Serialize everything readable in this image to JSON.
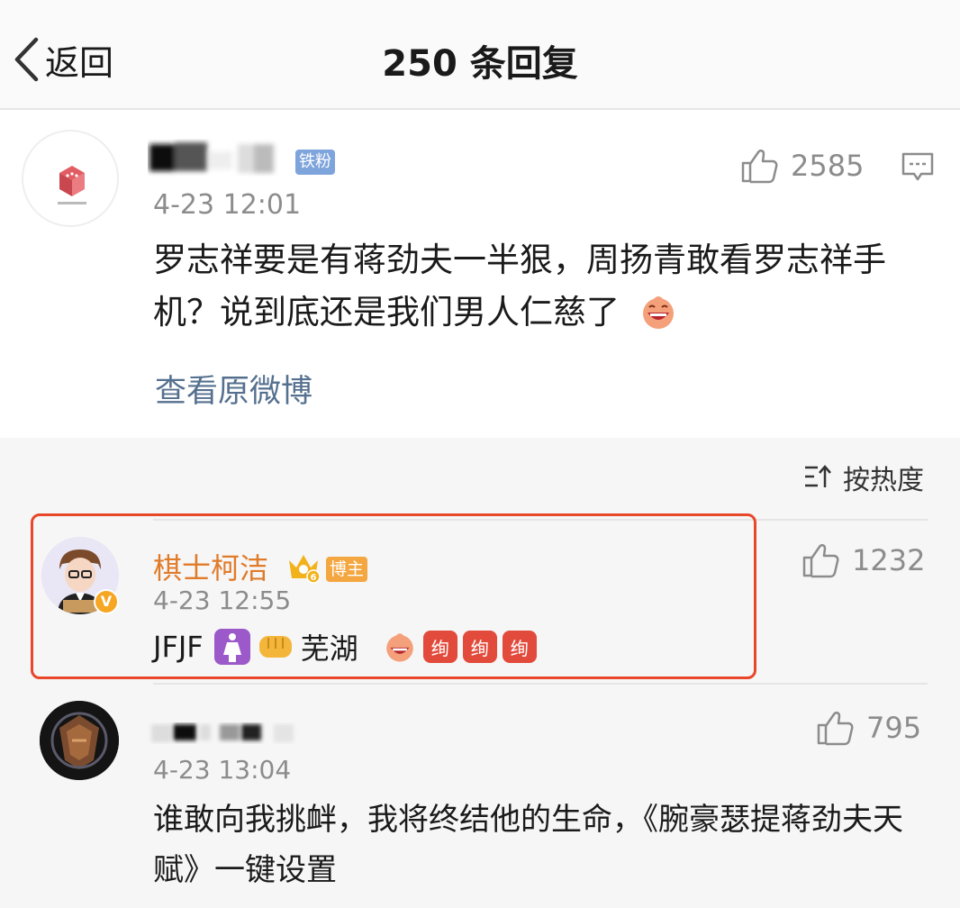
{
  "header": {
    "back_label": "返回",
    "title": "250 条回复"
  },
  "main_post": {
    "badge": "铁粉",
    "time": "4-23 12:01",
    "likes": "2585",
    "content": "罗志祥要是有蒋劲夫一半狠，周扬青敢看罗志祥手机？说到底还是我们男人仁慈了",
    "emoji": "laughing-face-emoji",
    "view_original": "查看原微博"
  },
  "replies_header": {
    "sort_label": "按热度",
    "sort_icon": "sort-icon"
  },
  "replies": [
    {
      "username": "棋士柯洁",
      "crown_level": "6",
      "badge": "博主",
      "verified_mark": "V",
      "time": "4-23 12:55",
      "likes": "1232",
      "text_1": "JFJF",
      "text_2": "芜湖",
      "emoji_tag": "绚",
      "highlighted": true,
      "highlight_color": "#e8472a"
    },
    {
      "time": "4-23 13:04",
      "likes": "795",
      "content": "谁敢向我挑衅，我将终结他的生命，《腕豪瑟提蒋劲夫天赋》一键设置"
    }
  ],
  "colors": {
    "link": "#55708f",
    "username_vip": "#e07b2a",
    "badge_blue": "#7ea4dc",
    "badge_orange": "#f4a640"
  }
}
